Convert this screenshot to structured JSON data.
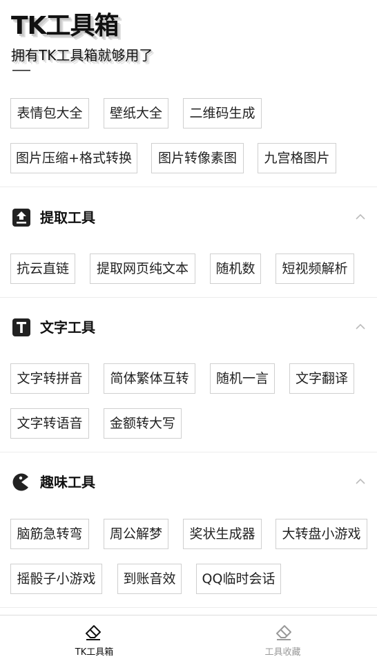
{
  "header": {
    "title": "TK工具箱",
    "subtitle": "拥有TK工具箱就够用了"
  },
  "top_tools": [
    "表情包大全",
    "壁纸大全",
    "二维码生成",
    "图片压缩+格式转换",
    "图片转像素图",
    "九宫格图片"
  ],
  "sections": [
    {
      "title": "提取工具",
      "icon": "upload-box-icon",
      "items": [
        "抗云直链",
        "提取网页纯文本",
        "随机数",
        "短视频解析"
      ]
    },
    {
      "title": "文字工具",
      "icon": "text-box-icon",
      "items": [
        "文字转拼音",
        "简体繁体互转",
        "随机一言",
        "文字翻译",
        "文字转语音",
        "金额转大写"
      ]
    },
    {
      "title": "趣味工具",
      "icon": "pacman-icon",
      "items": [
        "脑筋急转弯",
        "周公解梦",
        "奖状生成器",
        "大转盘小游戏",
        "摇骰子小游戏",
        "到账音效",
        "QQ临时会话"
      ]
    }
  ],
  "tabbar": {
    "tabs": [
      {
        "label": "TK工具箱",
        "icon": "eraser-icon",
        "active": true
      },
      {
        "label": "工具收藏",
        "icon": "eraser-icon",
        "active": false
      }
    ]
  },
  "colors": {
    "active_tab": "#111111",
    "inactive_tab": "#999999",
    "tag_border": "#cfcfcf",
    "divider": "#ececec"
  }
}
